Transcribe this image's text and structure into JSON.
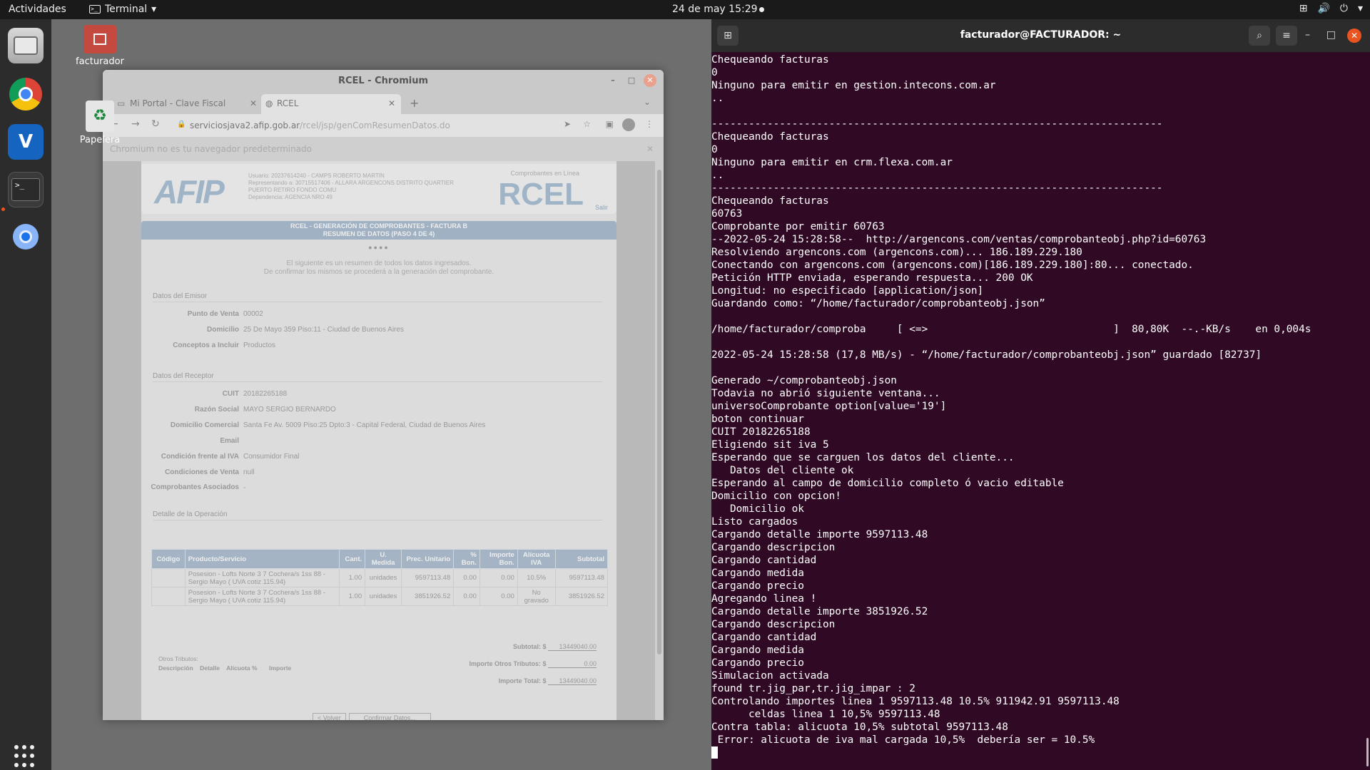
{
  "topbar": {
    "activities": "Actividades",
    "app_name": "Terminal",
    "clock": "24 de may  15:29"
  },
  "desktop": {
    "home_label": "facturador",
    "trash_label": "Papelera"
  },
  "browser": {
    "title": "RCEL - Chromium",
    "tabs": [
      {
        "label": "Mi Portal - Clave Fiscal"
      },
      {
        "label": "RCEL"
      }
    ],
    "url_host": "serviciosjava2.afip.gob.ar",
    "url_path": "/rcel/jsp/genComResumenDatos.do",
    "banner": "Chromium no es tu navegador predeterminado"
  },
  "rcel": {
    "logo_afip": "AFIP",
    "user_line": "Usuario: 20237614240 - CAMPS ROBERTO MARTIN",
    "rep_line": "Representando a: 30715517406 - ALLARA ARGENCONS DISTRITO QUARTIER PUERTO RETIRO FONDO COMU",
    "dep_line": "Dependencia: AGENCIA NRO 49",
    "logo_rcel": "RCEL",
    "logo_sub": "Comprobantes en Línea",
    "salir": "Salir",
    "section_title": "RCEL - GENERACIÓN DE COMPROBANTES - FACTURA B",
    "section_sub": "RESUMEN DE DATOS (PASO 4 DE 4)",
    "steps": "●●●●",
    "intro_1": "El siguiente es un resumen de todos los datos ingresados.",
    "intro_2": "De confirmar los mismos se procederá a la generación del comprobante.",
    "emisor_title": "Datos del Emisor",
    "emisor": [
      {
        "k": "Punto de Venta",
        "v": "00002"
      },
      {
        "k": "Domicilio",
        "v": "25 De Mayo 359 Piso:11 - Ciudad de Buenos Aires"
      },
      {
        "k": "Conceptos a Incluir",
        "v": "Productos"
      }
    ],
    "receptor_title": "Datos del Receptor",
    "receptor": [
      {
        "k": "CUIT",
        "v": "20182265188"
      },
      {
        "k": "Razón Social",
        "v": "MAYO SERGIO BERNARDO"
      },
      {
        "k": "Domicilio Comercial",
        "v": "Santa Fe Av. 5009 Piso:25 Dpto:3 - Capital Federal, Ciudad de Buenos Aires"
      },
      {
        "k": "Email",
        "v": ""
      },
      {
        "k": "Condición frente al IVA",
        "v": "Consumidor Final"
      },
      {
        "k": "Condiciones de Venta",
        "v": "null"
      },
      {
        "k": "Comprobantes Asociados",
        "v": "-"
      }
    ],
    "detalle_title": "Detalle de la Operación",
    "columns": [
      "Código",
      "Producto/Servicio",
      "Cant.",
      "U. Medida",
      "Prec. Unitario",
      "% Bon.",
      "Importe Bon.",
      "Alícuota IVA",
      "Subtotal"
    ],
    "rows": [
      [
        "",
        "Posesion - Lofts Norte 3 7 Cochera/s 1ss 88 - Sergio Mayo ( UVA cotiz 115.94)",
        "1.00",
        "unidades",
        "9597113.48",
        "0.00",
        "0.00",
        "10.5%",
        "9597113.48"
      ],
      [
        "",
        "Posesion - Lofts Norte 3 7 Cochera/s 1ss 88 - Sergio Mayo ( UVA cotiz 115.94)",
        "1.00",
        "unidades",
        "3851926.52",
        "0.00",
        "0.00",
        "No gravado",
        "3851926.52"
      ]
    ],
    "subtotal_label": "Subtotal: $",
    "subtotal": "13449040.00",
    "otros_label": "Importe Otros Tributos: $",
    "otros": "0.00",
    "total_label": "Importe Total: $",
    "total": "13449040.00",
    "otros_tributos": "Otros Tributos:",
    "ot_cols": [
      "Descripción",
      "Detalle",
      "Alícuota %",
      "Importe"
    ],
    "btn_volver": "< Volver",
    "btn_confirmar": "Confirmar Datos..."
  },
  "terminal": {
    "title": "facturador@FACTURADOR: ~",
    "lines": [
      "Chequeando facturas",
      "0",
      "Ninguno para emitir en gestion.intecons.com.ar",
      "..",
      "",
      "-------------------------------------------------------------------------",
      "Chequeando facturas",
      "0",
      "Ninguno para emitir en crm.flexa.com.ar",
      "..",
      "-------------------------------------------------------------------------",
      "Chequeando facturas",
      "60763",
      "Comprobante por emitir 60763",
      "--2022-05-24 15:28:58--  http://argencons.com/ventas/comprobanteobj.php?id=60763",
      "Resolviendo argencons.com (argencons.com)... 186.189.229.180",
      "Conectando con argencons.com (argencons.com)[186.189.229.180]:80... conectado.",
      "Petición HTTP enviada, esperando respuesta... 200 OK",
      "Longitud: no especificado [application/json]",
      "Guardando como: “/home/facturador/comprobanteobj.json”",
      "",
      "/home/facturador/comproba     [ <=>                              ]  80,80K  --.-KB/s    en 0,004s",
      "",
      "2022-05-24 15:28:58 (17,8 MB/s) - “/home/facturador/comprobanteobj.json” guardado [82737]",
      "",
      "Generado ~/comprobanteobj.json",
      "Todavia no abrió siguiente ventana...",
      "universoComprobante option[value='19']",
      "boton continuar",
      "CUIT 20182265188",
      "Eligiendo sit iva 5",
      "Esperando que se carguen los datos del cliente...",
      "   Datos del cliente ok",
      "Esperando al campo de domicilio completo ó vacio editable",
      "Domicilio con opcion!",
      "   Domicilio ok",
      "Listo cargados",
      "Cargando detalle importe 9597113.48",
      "Cargando descripcion",
      "Cargando cantidad",
      "Cargando medida",
      "Cargando precio",
      "Agregando linea !",
      "Cargando detalle importe 3851926.52",
      "Cargando descripcion",
      "Cargando cantidad",
      "Cargando medida",
      "Cargando precio",
      "Simulacion activada",
      "found tr.jig_par,tr.jig_impar : 2",
      "Controlando importes linea 1 9597113.48 10.5% 911942.91 9597113.48",
      "      celdas linea 1 10,5% 9597113.48",
      "Contra tabla: alicuota 10,5% subtotal 9597113.48",
      " Error: alicuota de iva mal cargada 10,5%  debería ser = 10.5%"
    ]
  }
}
